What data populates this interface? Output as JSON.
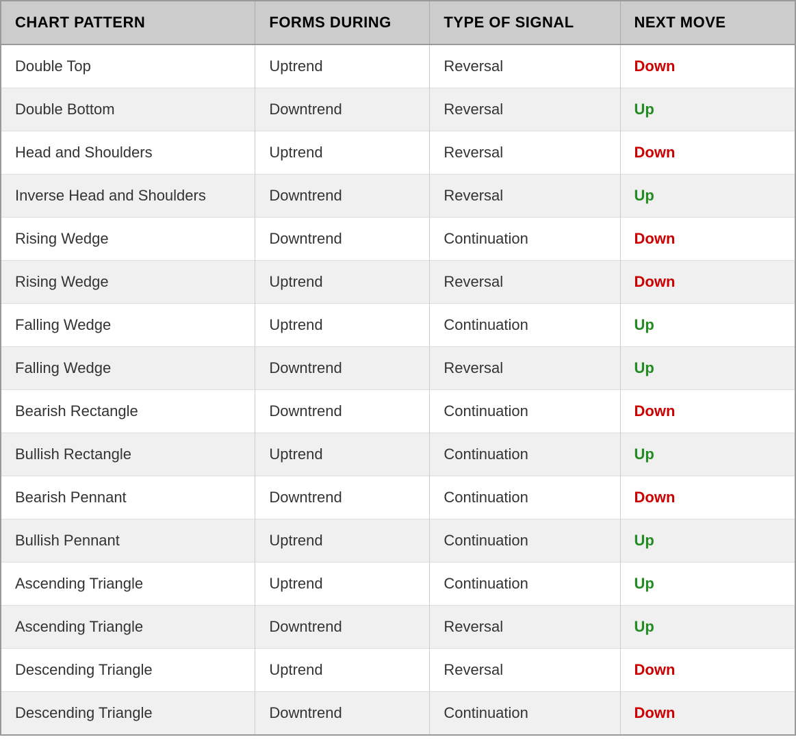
{
  "headers": {
    "col1": "CHART PATTERN",
    "col2": "FORMS DURING",
    "col3": "TYPE OF SIGNAL",
    "col4": "NEXT MOVE"
  },
  "rows": [
    {
      "pattern": "Double Top",
      "forms": "Uptrend",
      "signal": "Reversal",
      "next": "Down",
      "next_color": "red"
    },
    {
      "pattern": "Double Bottom",
      "forms": "Downtrend",
      "signal": "Reversal",
      "next": "Up",
      "next_color": "green"
    },
    {
      "pattern": "Head and Shoulders",
      "forms": "Uptrend",
      "signal": "Reversal",
      "next": "Down",
      "next_color": "red"
    },
    {
      "pattern": "Inverse Head and Shoulders",
      "forms": "Downtrend",
      "signal": "Reversal",
      "next": "Up",
      "next_color": "green"
    },
    {
      "pattern": "Rising Wedge",
      "forms": "Downtrend",
      "signal": "Continuation",
      "next": "Down",
      "next_color": "red"
    },
    {
      "pattern": "Rising Wedge",
      "forms": "Uptrend",
      "signal": "Reversal",
      "next": "Down",
      "next_color": "red"
    },
    {
      "pattern": "Falling Wedge",
      "forms": "Uptrend",
      "signal": "Continuation",
      "next": "Up",
      "next_color": "green"
    },
    {
      "pattern": "Falling Wedge",
      "forms": "Downtrend",
      "signal": "Reversal",
      "next": "Up",
      "next_color": "green"
    },
    {
      "pattern": "Bearish Rectangle",
      "forms": "Downtrend",
      "signal": "Continuation",
      "next": "Down",
      "next_color": "red"
    },
    {
      "pattern": "Bullish Rectangle",
      "forms": "Uptrend",
      "signal": "Continuation",
      "next": "Up",
      "next_color": "green"
    },
    {
      "pattern": "Bearish Pennant",
      "forms": "Downtrend",
      "signal": "Continuation",
      "next": "Down",
      "next_color": "red"
    },
    {
      "pattern": "Bullish Pennant",
      "forms": "Uptrend",
      "signal": "Continuation",
      "next": "Up",
      "next_color": "green"
    },
    {
      "pattern": "Ascending Triangle",
      "forms": "Uptrend",
      "signal": "Continuation",
      "next": "Up",
      "next_color": "green"
    },
    {
      "pattern": "Ascending Triangle",
      "forms": "Downtrend",
      "signal": "Reversal",
      "next": "Up",
      "next_color": "green"
    },
    {
      "pattern": "Descending Triangle",
      "forms": "Uptrend",
      "signal": "Reversal",
      "next": "Down",
      "next_color": "red"
    },
    {
      "pattern": "Descending Triangle",
      "forms": "Downtrend",
      "signal": "Continuation",
      "next": "Down",
      "next_color": "red"
    }
  ]
}
